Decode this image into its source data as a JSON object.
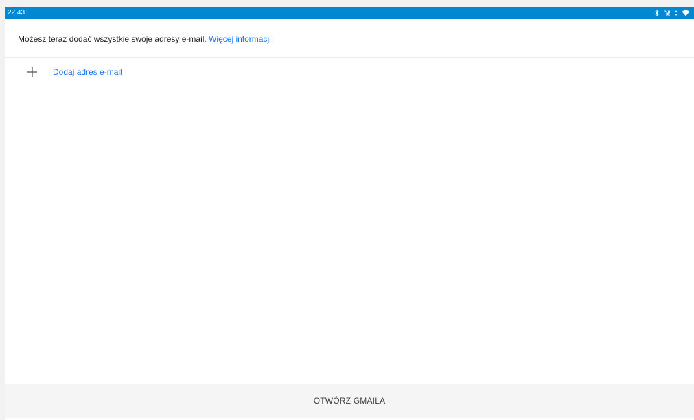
{
  "status_bar": {
    "time": "22:43",
    "background": "#0288d1",
    "icons": [
      "bluetooth-icon",
      "mute-icon",
      "network-icon",
      "wifi-icon"
    ]
  },
  "info": {
    "text": "Możesz teraz dodać wszystkie swoje adresy e-mail.",
    "link_label": "Więcej informacji"
  },
  "add_email": {
    "icon": "plus-icon",
    "label": "Dodaj adres e-mail",
    "color": "#1a73e8"
  },
  "footer": {
    "open_gmail_label": "OTWÓRZ GMAILA"
  }
}
